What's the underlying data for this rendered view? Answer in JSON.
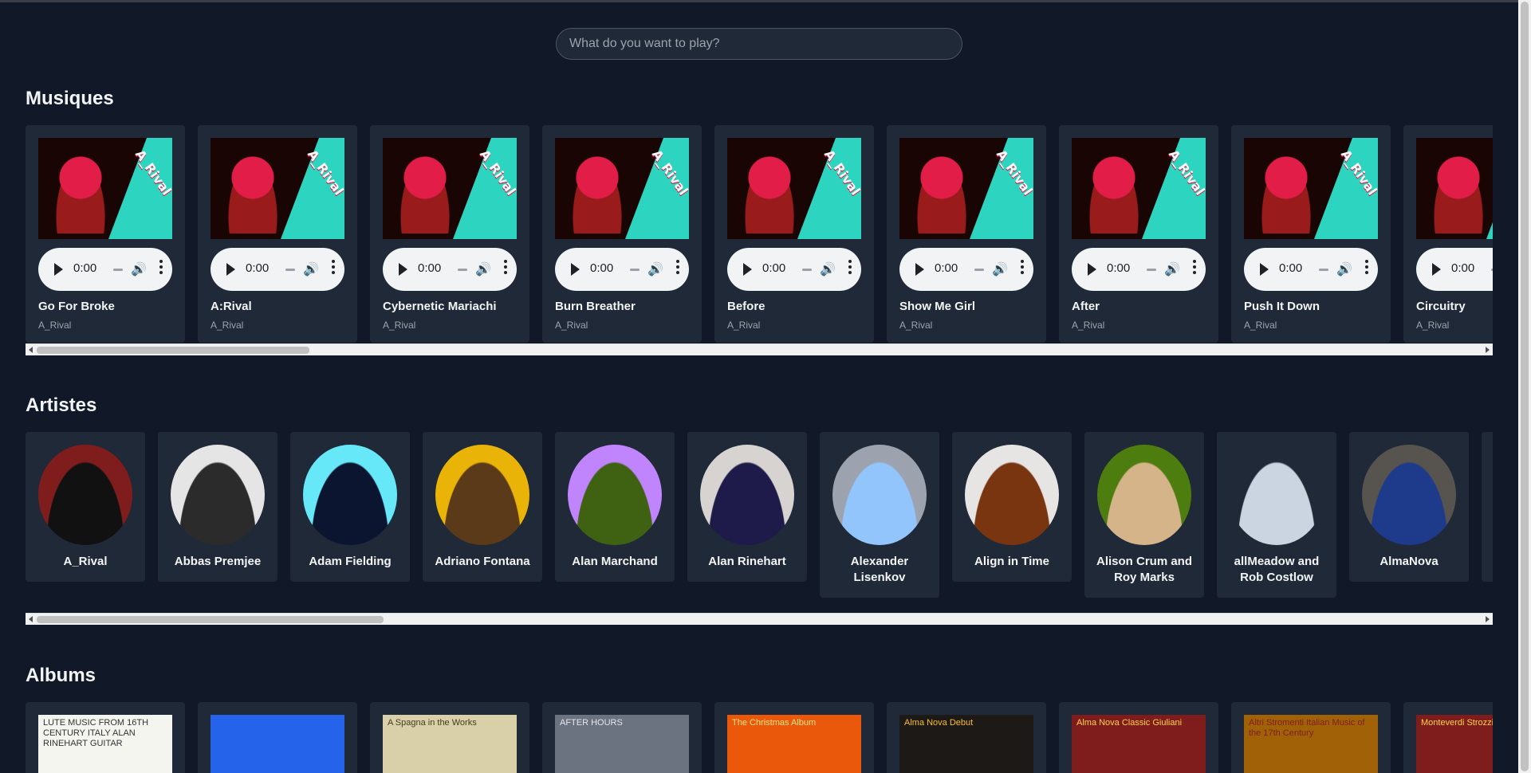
{
  "search": {
    "placeholder": "What do you want to play?"
  },
  "sections": {
    "songs": "Musiques",
    "artists": "Artistes",
    "albums": "Albums"
  },
  "songs": [
    {
      "title": "Go For Broke",
      "artist": "A_Rival",
      "time": "0:00"
    },
    {
      "title": "A:Rival",
      "artist": "A_Rival",
      "time": "0:00"
    },
    {
      "title": "Cybernetic Mariachi",
      "artist": "A_Rival",
      "time": "0:00"
    },
    {
      "title": "Burn Breather",
      "artist": "A_Rival",
      "time": "0:00"
    },
    {
      "title": "Before",
      "artist": "A_Rival",
      "time": "0:00"
    },
    {
      "title": "Show Me Girl",
      "artist": "A_Rival",
      "time": "0:00"
    },
    {
      "title": "After",
      "artist": "A_Rival",
      "time": "0:00"
    },
    {
      "title": "Push It Down",
      "artist": "A_Rival",
      "time": "0:00"
    },
    {
      "title": "Circuitry",
      "artist": "A_Rival",
      "time": "0:00"
    }
  ],
  "song_cover_logo": "A_Rival",
  "artists": [
    {
      "name": "A_Rival",
      "bg": "#7f1d1d",
      "fg": "#111111"
    },
    {
      "name": "Abbas Premjee",
      "bg": "#e5e5e5",
      "fg": "#2b2b2b"
    },
    {
      "name": "Adam Fielding",
      "bg": "#67e8f9",
      "fg": "#0b1530"
    },
    {
      "name": "Adriano Fontana",
      "bg": "#eab308",
      "fg": "#5b3a1a"
    },
    {
      "name": "Alan Marchand",
      "bg": "#c084fc",
      "fg": "#3f6212"
    },
    {
      "name": "Alan Rinehart",
      "bg": "#d6d3d1",
      "fg": "#1e1b4b"
    },
    {
      "name": "Alexander Lisenkov",
      "bg": "#9ca3af",
      "fg": "#93c5fd"
    },
    {
      "name": "Align in Time",
      "bg": "#e7e5e4",
      "fg": "#78350f"
    },
    {
      "name": "Alison Crum and Roy Marks",
      "bg": "#4d7c0f",
      "fg": "#d6b48a"
    },
    {
      "name": "allMeadow and Rob Costlow",
      "bg": "#1f2937",
      "fg": "#cbd5e1"
    },
    {
      "name": "AlmaNova",
      "bg": "#57534e",
      "fg": "#1e3a8a"
    }
  ],
  "albums": [
    {
      "text": "LUTE MUSIC FROM 16TH CENTURY ITALY ALAN RINEHART GUITAR",
      "bg": "#f5f5f0",
      "fg": "#333333"
    },
    {
      "text": "",
      "bg": "#2563eb",
      "fg": "#ffffff"
    },
    {
      "text": "A Spagna in the Works",
      "bg": "#d9cfa8",
      "fg": "#3f3f20"
    },
    {
      "text": "AFTER HOURS",
      "bg": "#6b7280",
      "fg": "#e5e7eb"
    },
    {
      "text": "The Christmas Album",
      "bg": "#ea580c",
      "fg": "#fde68a"
    },
    {
      "text": "Alma Nova Debut",
      "bg": "#1c1917",
      "fg": "#fbbf24"
    },
    {
      "text": "Alma Nova Classic Giuliani",
      "bg": "#7f1d1d",
      "fg": "#fcd34d"
    },
    {
      "text": "Altri Stromenti Italian Music of the 17th Century",
      "bg": "#a16207",
      "fg": "#7f1d1d"
    },
    {
      "text": "Monteverdi Strozzi Cazzati",
      "bg": "#7f1d1d",
      "fg": "#fcd34d"
    }
  ]
}
